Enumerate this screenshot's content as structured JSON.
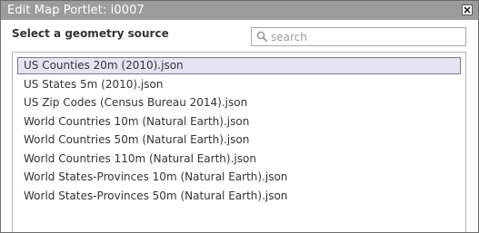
{
  "window": {
    "title": "Edit Map Portlet: i0007",
    "close_icon": "close-icon"
  },
  "heading": "Select a geometry source",
  "search": {
    "placeholder": "search",
    "value": "",
    "icon": "search-icon"
  },
  "sources": [
    {
      "label": "US Counties 20m (2010).json",
      "selected": true
    },
    {
      "label": "US States 5m (2010).json",
      "selected": false
    },
    {
      "label": "US Zip Codes (Census Bureau 2014).json",
      "selected": false
    },
    {
      "label": "World Countries 10m (Natural Earth).json",
      "selected": false
    },
    {
      "label": "World Countries 50m (Natural Earth).json",
      "selected": false
    },
    {
      "label": "World Countries 110m (Natural Earth).json",
      "selected": false
    },
    {
      "label": "World States-Provinces 10m (Natural Earth).json",
      "selected": false
    },
    {
      "label": "World States-Provinces 50m (Natural Earth).json",
      "selected": false
    }
  ],
  "colors": {
    "titlebar": "#9c9c9c",
    "selection": "#e4e4f2"
  }
}
